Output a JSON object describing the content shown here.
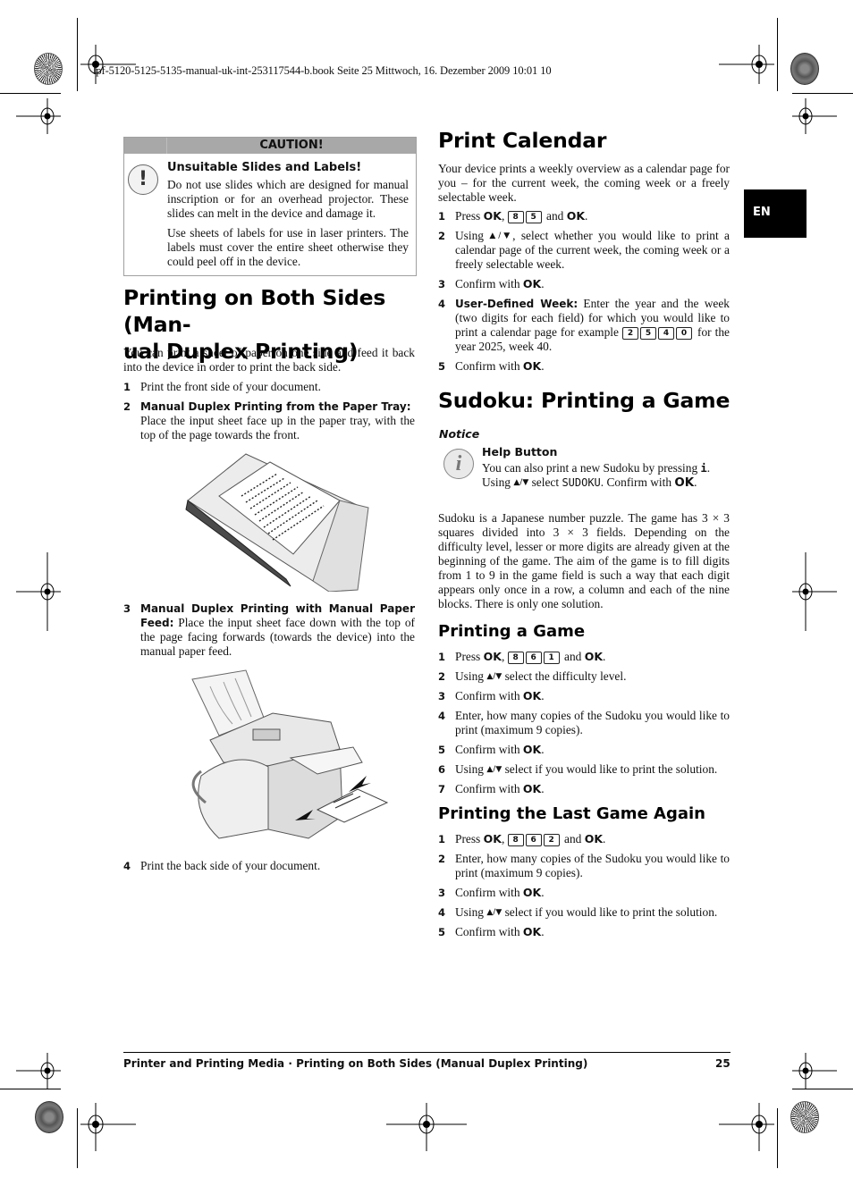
{
  "print_meta": "lpf-5120-5125-5135-manual-uk-int-253117544-b.book  Seite 25  Mittwoch, 16. Dezember 2009  10:01 10",
  "language_tab": "EN",
  "caution": {
    "header": "CAUTION!",
    "icon": "exclamation-icon",
    "title": "Unsuitable Slides and Labels!",
    "paragraphs": [
      "Do not use slides which are designed for manual inscription or for an overhead projector. These slides can melt in the device and damage it.",
      "Use sheets of labels for use in laser printers. The labels must cover the entire sheet otherwise they could peel off in the device."
    ]
  },
  "duplex": {
    "heading": "Printing on Both Sides (Manual Duplex Printing)",
    "heading_line1": "Printing on Both Sides (Man-",
    "heading_line2": "ual Duplex Printing)",
    "intro": "You can print a sheet of paper on one side and feed it back into the device in order to print the back side.",
    "steps": [
      {
        "num": "1",
        "text": "Print the front side of your document."
      },
      {
        "num": "2",
        "bold": "Manual Duplex Printing from the Paper Tray:",
        "text": "Place the input sheet face up in the paper tray, with the top of the page towards the front."
      },
      {
        "num": "3",
        "bold": "Manual Duplex Printing with Manual Paper Feed:",
        "text": "Place the input sheet face down with the top of the page facing forwards (towards the device) into the manual paper feed."
      },
      {
        "num": "4",
        "text": "Print the back side of your document."
      }
    ],
    "figures": [
      "paper-tray-illustration",
      "fax-device-manual-feed-illustration"
    ]
  },
  "calendar": {
    "heading": "Print Calendar",
    "intro": "Your device prints a weekly overview as a calendar page for you – for the current week, the coming week or a freely selectable week.",
    "steps": [
      {
        "num": "1",
        "pre": "Press",
        "ok1": "OK",
        "keys": [
          "8",
          "5"
        ],
        "mid": "and",
        "ok2": "OK"
      },
      {
        "num": "2",
        "pre": "Using",
        "text": ", select whether you would like to print a calendar page of the current week, the coming week or a freely selectable week."
      },
      {
        "num": "3",
        "pre": "Confirm with",
        "ok1": "OK"
      },
      {
        "num": "4",
        "bold": "User-Defined Week:",
        "text": "Enter the year and the week (two digits for each field) for which you would like to print a calendar page for example",
        "keys": [
          "2",
          "5",
          "4",
          "0"
        ],
        "tail": "for the year 2025, week 40."
      },
      {
        "num": "5",
        "pre": "Confirm with",
        "ok1": "OK"
      }
    ]
  },
  "sudoku": {
    "heading": "Sudoku: Printing a Game",
    "notice_label": "Notice",
    "notice_icon": "info-icon",
    "notice_title": "Help Button",
    "notice_text_1": "You can also print a new Sudoku by pressing",
    "notice_key": "i",
    "notice_text_2": "Using",
    "notice_text_3": "select",
    "notice_menu": "SUDOKU",
    "notice_text_4": ". Confirm with",
    "notice_ok": "OK",
    "intro": "Sudoku is a Japanese number puzzle. The game has 3 × 3 squares divided into 3 × 3 fields. Depending on the difficulty level, lesser or more digits are already given at the beginning of the game. The aim of the game is to fill digits from 1 to 9 in the game field is such a way that each digit appears only once in a row, a column and each of the nine blocks. There is only one solution.",
    "printing_game": {
      "heading": "Printing a Game",
      "steps": [
        {
          "num": "1",
          "pre": "Press",
          "ok1": "OK",
          "keys": [
            "8",
            "6",
            "1"
          ],
          "mid": "and",
          "ok2": "OK"
        },
        {
          "num": "2",
          "pre": "Using",
          "text": "select the difficulty level."
        },
        {
          "num": "3",
          "pre": "Confirm with",
          "ok1": "OK"
        },
        {
          "num": "4",
          "text": "Enter, how many copies of the Sudoku you would like to print (maximum 9 copies)."
        },
        {
          "num": "5",
          "pre": "Confirm with",
          "ok1": "OK"
        },
        {
          "num": "6",
          "pre": "Using",
          "text": "select if you would like to print the solution."
        },
        {
          "num": "7",
          "pre": "Confirm with",
          "ok1": "OK"
        }
      ]
    },
    "last_game": {
      "heading": "Printing the Last Game Again",
      "steps": [
        {
          "num": "1",
          "pre": "Press",
          "ok1": "OK",
          "keys": [
            "8",
            "6",
            "2"
          ],
          "mid": "and",
          "ok2": "OK"
        },
        {
          "num": "2",
          "text": "Enter, how many copies of the Sudoku you would like to print (maximum 9 copies)."
        },
        {
          "num": "3",
          "pre": "Confirm with",
          "ok1": "OK"
        },
        {
          "num": "4",
          "pre": "Using",
          "text": "select if you would like to print the solution."
        },
        {
          "num": "5",
          "pre": "Confirm with",
          "ok1": "OK"
        }
      ]
    }
  },
  "arrows_glyph": "▲/▼",
  "footer": {
    "text": "Printer and Printing Media · Printing on Both Sides (Manual Duplex Printing)",
    "page": "25"
  }
}
